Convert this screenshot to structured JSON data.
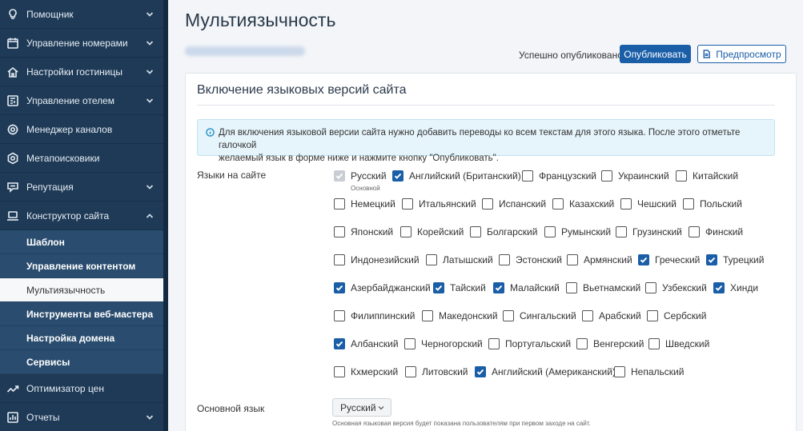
{
  "sidebar": {
    "items_top": [
      {
        "label": "Помощник",
        "icon": "lightbulb-icon",
        "chevron": "down"
      },
      {
        "label": "Управление номерами",
        "icon": "calendar-icon",
        "chevron": "down"
      },
      {
        "label": "Настройки гостиницы",
        "icon": "house-icon",
        "chevron": "down"
      },
      {
        "label": "Управление отелем",
        "icon": "dashboard-icon",
        "chevron": "down"
      },
      {
        "label": "Менеджер каналов",
        "icon": "cog-network-icon",
        "chevron": ""
      },
      {
        "label": "Метапоисковики",
        "icon": "hexagon-search-icon",
        "chevron": ""
      },
      {
        "label": "Репутация",
        "icon": "chat-icon",
        "chevron": "down"
      },
      {
        "label": "Конструктор сайта",
        "icon": "laptop-icon",
        "chevron": "up"
      }
    ],
    "sub_items": [
      {
        "label": "Шаблон",
        "active": false
      },
      {
        "label": "Управление контентом",
        "active": false
      },
      {
        "label": "Мультиязычность",
        "active": true
      },
      {
        "label": "Инструменты веб-мастера",
        "active": false
      },
      {
        "label": "Настройка домена",
        "active": false
      },
      {
        "label": "Сервисы",
        "active": false
      }
    ],
    "items_bottom": [
      {
        "label": "Оптимизатор цен",
        "icon": "trend-icon",
        "chevron": ""
      },
      {
        "label": "Отчеты",
        "icon": "report-icon",
        "chevron": "down"
      }
    ]
  },
  "header": {
    "title": "Мультиязычность",
    "status": "Успешно опубликовано",
    "publish_label": "Опубликовать",
    "preview_label": "Предпросмотр"
  },
  "card": {
    "title": "Включение языковых версий сайта",
    "info_line1": "Для включения языковой версии сайта нужно добавить переводы ко всем текстам для этого языка. После этого отметьте галочкой",
    "info_line2": "желаемый язык в форме ниже и нажмите кнопку \"Опубликовать\".",
    "languages_label": "Языки на сайте",
    "default_note": "Основной",
    "main_language_label": "Основной язык",
    "main_language_value": "Русский",
    "main_language_hint": "Основная языковая версия будет показана пользователям при первом заходе на сайт."
  },
  "languages": [
    {
      "label": "Русский",
      "checked": true,
      "disabled": true
    },
    {
      "label": "Английский (Британский)",
      "checked": true
    },
    {
      "label": "Французский",
      "checked": false
    },
    {
      "label": "Украинский",
      "checked": false
    },
    {
      "label": "Китайский",
      "checked": false
    },
    {
      "label": "Немецкий",
      "checked": false
    },
    {
      "label": "Итальянский",
      "checked": false
    },
    {
      "label": "Испанский",
      "checked": false
    },
    {
      "label": "Казахский",
      "checked": false
    },
    {
      "label": "Чешский",
      "checked": false
    },
    {
      "label": "Польский",
      "checked": false
    },
    {
      "label": "Японский",
      "checked": false
    },
    {
      "label": "Корейский",
      "checked": false
    },
    {
      "label": "Болгарский",
      "checked": false
    },
    {
      "label": "Румынский",
      "checked": false
    },
    {
      "label": "Грузинский",
      "checked": false
    },
    {
      "label": "Финский",
      "checked": false
    },
    {
      "label": "Индонезийский",
      "checked": false
    },
    {
      "label": "Латышский",
      "checked": false
    },
    {
      "label": "Эстонский",
      "checked": false
    },
    {
      "label": "Армянский",
      "checked": false
    },
    {
      "label": "Греческий",
      "checked": true
    },
    {
      "label": "Турецкий",
      "checked": true
    },
    {
      "label": "Азербайджанский",
      "checked": true
    },
    {
      "label": "Тайский",
      "checked": true
    },
    {
      "label": "Малайский",
      "checked": true
    },
    {
      "label": "Вьетнамский",
      "checked": false
    },
    {
      "label": "Узбекский",
      "checked": false
    },
    {
      "label": "Хинди",
      "checked": true
    },
    {
      "label": "Филиппинский",
      "checked": false
    },
    {
      "label": "Македонский",
      "checked": false
    },
    {
      "label": "Сингальский",
      "checked": false
    },
    {
      "label": "Арабский",
      "checked": false
    },
    {
      "label": "Сербский",
      "checked": false
    },
    {
      "label": "Албанский",
      "checked": true
    },
    {
      "label": "Черногорский",
      "checked": false
    },
    {
      "label": "Португальский",
      "checked": false
    },
    {
      "label": "Венгерский",
      "checked": false
    },
    {
      "label": "Шведский",
      "checked": false
    },
    {
      "label": "Кхмерский",
      "checked": false
    },
    {
      "label": "Литовский",
      "checked": false
    },
    {
      "label": "Английский (Американский)",
      "checked": true
    },
    {
      "label": "Непальский",
      "checked": false
    }
  ]
}
